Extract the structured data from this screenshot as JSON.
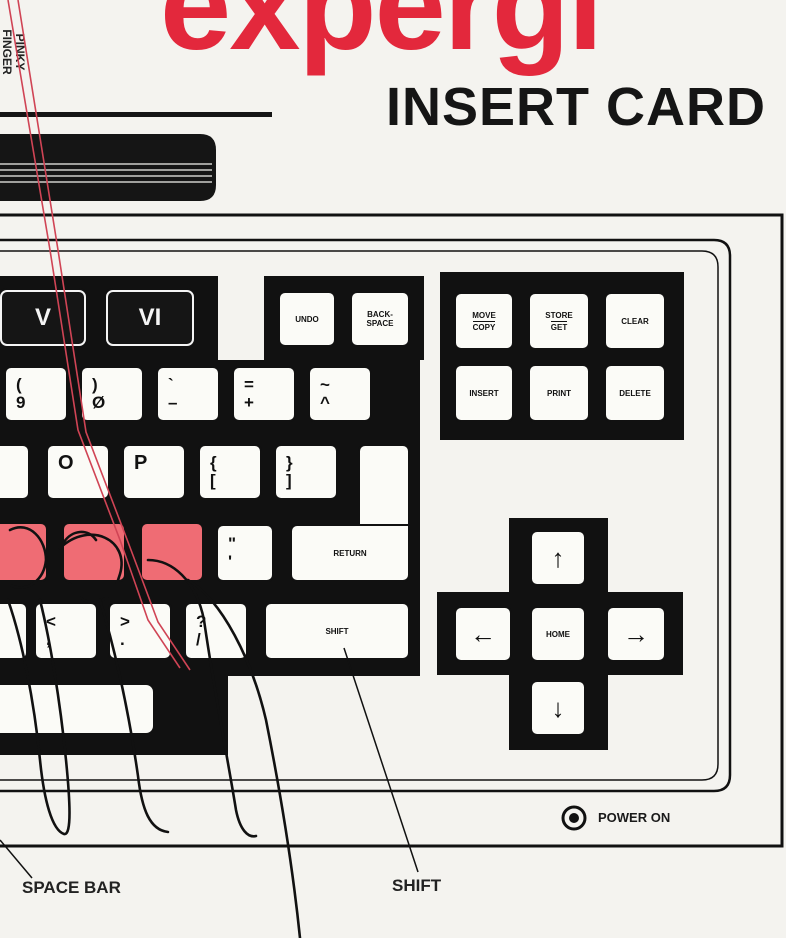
{
  "header": {
    "brand_fragment": "expergi",
    "title": "INSERT CARD",
    "pinky_label": "PINKY\nFINGER"
  },
  "function_keys": [
    "V",
    "VI"
  ],
  "edit_keys": {
    "undo": "UNDO",
    "backspace": "BACK-\nSPACE"
  },
  "command_keys": {
    "move": "MOVE",
    "copy": "COPY",
    "store": "STORE",
    "get": "GET",
    "clear": "CLEAR",
    "insert": "INSERT",
    "print": "PRINT",
    "delete": "DELETE"
  },
  "number_row": [
    {
      "top": "(",
      "bottom": "9"
    },
    {
      "top": ")",
      "bottom": "Ø"
    },
    {
      "top": "`",
      "bottom": "–"
    },
    {
      "top": "=",
      "bottom": "+"
    },
    {
      "top": "~",
      "bottom": "^"
    }
  ],
  "qwerty_row": [
    {
      "label": "O"
    },
    {
      "label": "P"
    },
    {
      "top": "{",
      "bottom": "["
    },
    {
      "top": "}",
      "bottom": "]"
    }
  ],
  "home_row_symbol": {
    "top": "\"",
    "bottom": "'"
  },
  "shift_row": [
    {
      "top": "<",
      "bottom": ","
    },
    {
      "top": ">",
      "bottom": "."
    },
    {
      "top": "?",
      "bottom": "/"
    }
  ],
  "return_label": "RETURN",
  "shift_label": "SHIFT",
  "arrows": {
    "home": "HOME",
    "up": "↑",
    "down": "↓",
    "left": "←",
    "right": "→"
  },
  "power_label": "POWER ON",
  "callouts": {
    "space_bar": "SPACE BAR",
    "shift": "SHIFT"
  },
  "colors": {
    "brand_red": "#e3283c",
    "finger_key_red": "#ef6c74",
    "ink": "#111111",
    "paper": "#f4f3ef"
  }
}
